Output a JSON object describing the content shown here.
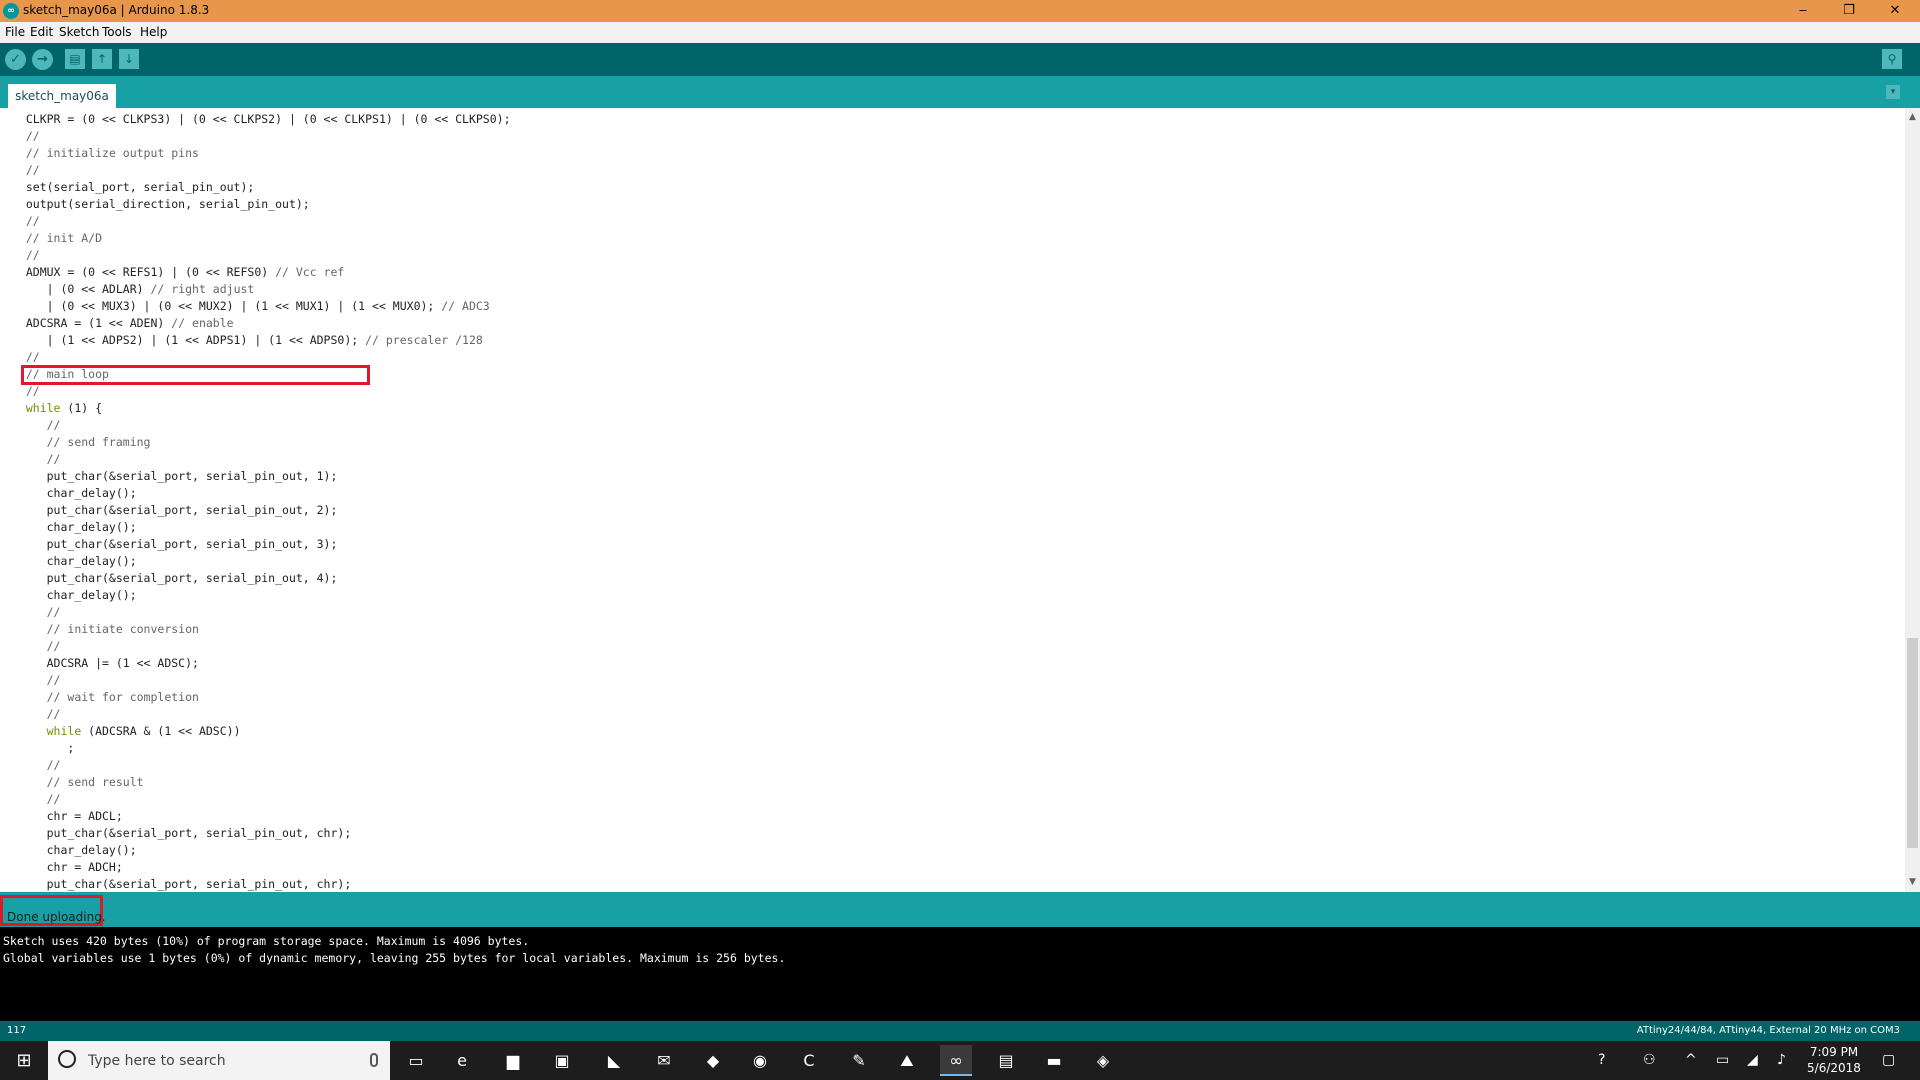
{
  "window": {
    "title": "sketch_may06a | Arduino 1.8.3",
    "app_icon": "arduino-icon",
    "minimize": "‒",
    "restore": "❐",
    "close": "✕"
  },
  "menu": [
    "File",
    "Edit",
    "Sketch",
    "Tools",
    "Help"
  ],
  "toolbar": {
    "verify": "✓",
    "upload": "→",
    "new": "▤",
    "open": "↑",
    "save": "↓",
    "serial_monitor": "⚲"
  },
  "tabs": [
    {
      "label": "sketch_may06a",
      "active": true
    }
  ],
  "tab_menu": "▾",
  "code_lines": [
    "  CLKPR = (0 << CLKPS3) | (0 << CLKPS2) | (0 << CLKPS1) | (0 << CLKPS0);",
    "  //",
    "  // initialize output pins",
    "  //",
    "  set(serial_port, serial_pin_out);",
    "  output(serial_direction, serial_pin_out);",
    "  //",
    "  // init A/D",
    "  //",
    "  ADMUX = (0 << REFS1) | (0 << REFS0) // Vcc ref",
    "     | (0 << ADLAR) // right adjust",
    "     | (0 << MUX3) | (0 << MUX2) | (1 << MUX1) | (1 << MUX0); // ADC3",
    "  ADCSRA = (1 << ADEN) // enable",
    "     | (1 << ADPS2) | (1 << ADPS1) | (1 << ADPS0); // prescaler /128",
    "  //",
    "  // main loop",
    "  //",
    "  while (1) {",
    "     //",
    "     // send framing",
    "     //",
    "     put_char(&serial_port, serial_pin_out, 1);",
    "     char_delay();",
    "     put_char(&serial_port, serial_pin_out, 2);",
    "     char_delay();",
    "     put_char(&serial_port, serial_pin_out, 3);",
    "     char_delay();",
    "     put_char(&serial_port, serial_pin_out, 4);",
    "     char_delay();",
    "     //",
    "     // initiate conversion",
    "     //",
    "     ADCSRA |= (1 << ADSC);",
    "     //",
    "     // wait for completion",
    "     //",
    "     while (ADCSRA & (1 << ADSC))",
    "        ;",
    "     //",
    "     // send result",
    "     //",
    "     chr = ADCL;",
    "     put_char(&serial_port, serial_pin_out, chr);",
    "     char_delay();",
    "     chr = ADCH;",
    "     put_char(&serial_port, serial_pin_out, chr);"
  ],
  "status": {
    "message": "Done uploading."
  },
  "console": [
    "Sketch uses 420 bytes (10%) of program storage space. Maximum is 4096 bytes.",
    "Global variables use 1 bytes (0%) of dynamic memory, leaving 255 bytes for local variables. Maximum is 256 bytes."
  ],
  "footer": {
    "line_number": "117",
    "board": "ATtiny24/44/84, ATtiny44, External 20 MHz on COM3"
  },
  "taskbar": {
    "start": "⊞",
    "search_placeholder": "Type here to search",
    "apps": [
      {
        "name": "task-view-icon",
        "glyph": "▭"
      },
      {
        "name": "edge-icon",
        "glyph": "e"
      },
      {
        "name": "file-explorer-icon",
        "glyph": "▆"
      },
      {
        "name": "store-icon",
        "glyph": "▣"
      },
      {
        "name": "pdf-icon",
        "glyph": "◣"
      },
      {
        "name": "mail-icon",
        "glyph": "✉"
      },
      {
        "name": "inkscape-icon",
        "glyph": "◆"
      },
      {
        "name": "chrome-icon",
        "glyph": "◉"
      },
      {
        "name": "cortana-app-icon",
        "glyph": "C"
      },
      {
        "name": "draw-app-icon",
        "glyph": "✎"
      },
      {
        "name": "photos-icon",
        "glyph": "⛰"
      },
      {
        "name": "arduino-icon",
        "glyph": "∞"
      },
      {
        "name": "notepad-icon",
        "glyph": "▤"
      },
      {
        "name": "terminal-icon",
        "glyph": "▬"
      },
      {
        "name": "python-icon",
        "glyph": "◈"
      }
    ],
    "tray": {
      "help": "?",
      "people": "⚇",
      "chevron": "^",
      "battery": "▭",
      "network": "◢",
      "volume": "♪",
      "notifications": "▢"
    },
    "time": "7:09 PM",
    "date": "5/6/2018"
  }
}
